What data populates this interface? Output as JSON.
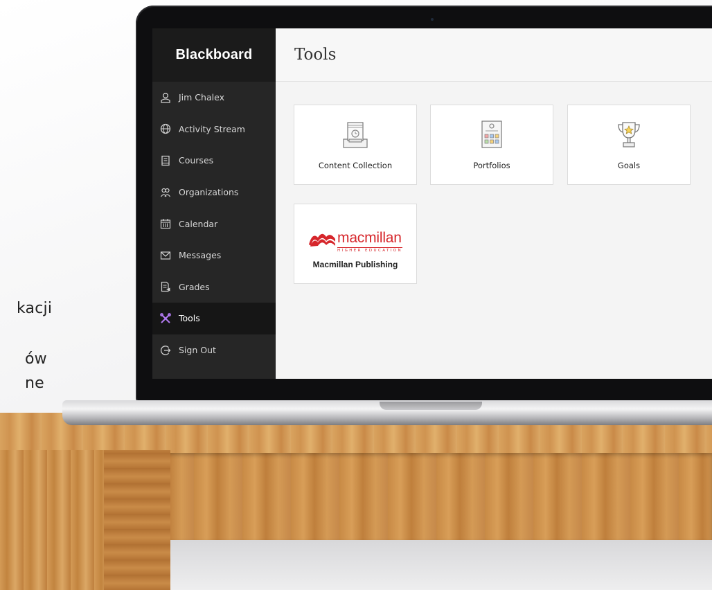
{
  "background_slide": {
    "fragments": [
      "kacji",
      "ów",
      "ne"
    ]
  },
  "app": {
    "brand": "Blackboard",
    "page_title": "Tools"
  },
  "sidebar": {
    "items": [
      {
        "label": "Jim Chalex",
        "icon": "user-icon"
      },
      {
        "label": "Activity Stream",
        "icon": "globe-icon"
      },
      {
        "label": "Courses",
        "icon": "book-icon"
      },
      {
        "label": "Organizations",
        "icon": "people-icon"
      },
      {
        "label": "Calendar",
        "icon": "calendar-icon"
      },
      {
        "label": "Messages",
        "icon": "envelope-icon"
      },
      {
        "label": "Grades",
        "icon": "grades-icon"
      },
      {
        "label": "Tools",
        "icon": "tools-icon",
        "active": true
      },
      {
        "label": "Sign Out",
        "icon": "sign-out-icon"
      }
    ]
  },
  "tools": [
    {
      "label": "Content Collection",
      "icon": "content-collection-icon"
    },
    {
      "label": "Portfolios",
      "icon": "portfolios-icon"
    },
    {
      "label": "Goals",
      "icon": "trophy-icon"
    },
    {
      "label": "Macmillan Publishing",
      "icon": "macmillan-logo",
      "logo_word": "macmillan",
      "logo_sub": "HIGHER EDUCATION"
    }
  ],
  "colors": {
    "sidebar_bg": "#262626",
    "active_accent": "#b57cf5",
    "macmillan_red": "#d6262b"
  }
}
